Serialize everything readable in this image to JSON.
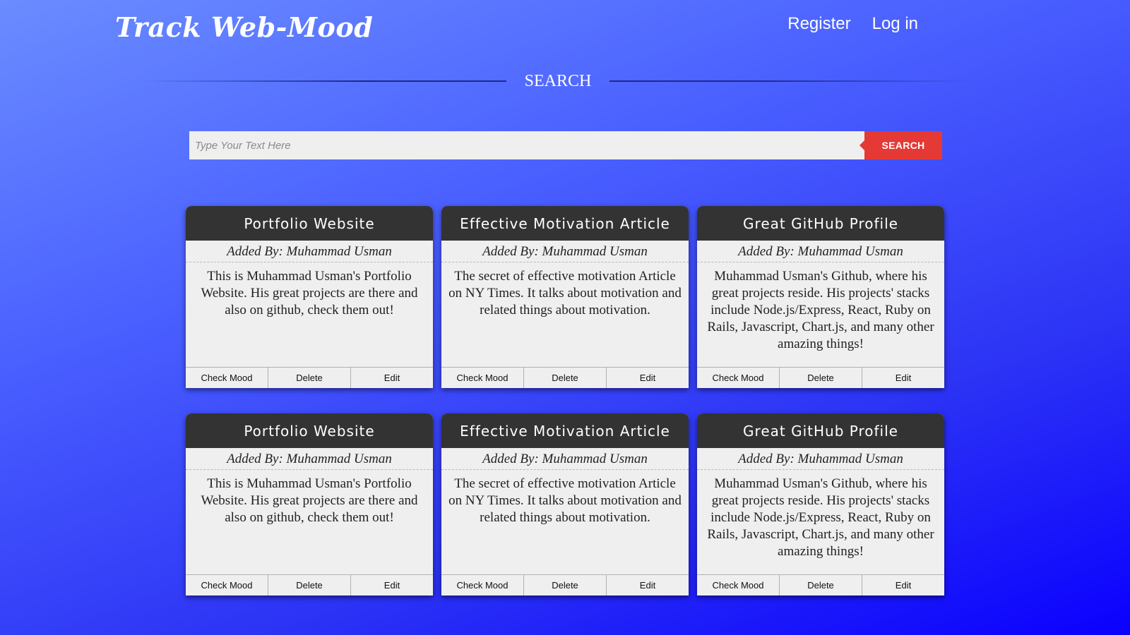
{
  "header": {
    "logo": "Track Web-Mood",
    "nav": [
      {
        "label": "Register"
      },
      {
        "label": "Log in"
      }
    ]
  },
  "search": {
    "heading": "SEARCH",
    "placeholder": "Type Your Text Here",
    "value": "",
    "button_label": "SEARCH"
  },
  "cards": [
    {
      "title": "Portfolio Website",
      "author": "Added By: Muhammad Usman",
      "description": "This is Muhammad Usman's Portfolio Website. His great projects are there and also on github, check them out!",
      "actions": [
        "Check Mood",
        "Delete",
        "Edit"
      ]
    },
    {
      "title": "Effective Motivation Article",
      "author": "Added By: Muhammad Usman",
      "description": "The secret of effective motivation Article on NY Times. It talks about motivation and related things about motivation.",
      "actions": [
        "Check Mood",
        "Delete",
        "Edit"
      ]
    },
    {
      "title": "Great GitHub Profile",
      "author": "Added By: Muhammad Usman",
      "description": "Muhammad Usman's Github, where his great projects reside. His projects' stacks include Node.js/Express, React, Ruby on Rails, Javascript, Chart.js, and many other amazing things!",
      "actions": [
        "Check Mood",
        "Delete",
        "Edit"
      ]
    },
    {
      "title": "Portfolio Website",
      "author": "Added By: Muhammad Usman",
      "description": "This is Muhammad Usman's Portfolio Website. His great projects are there and also on github, check them out!",
      "actions": [
        "Check Mood",
        "Delete",
        "Edit"
      ]
    },
    {
      "title": "Effective Motivation Article",
      "author": "Added By: Muhammad Usman",
      "description": "The secret of effective motivation Article on NY Times. It talks about motivation and related things about motivation.",
      "actions": [
        "Check Mood",
        "Delete",
        "Edit"
      ]
    },
    {
      "title": "Great GitHub Profile",
      "author": "Added By: Muhammad Usman",
      "description": "Muhammad Usman's Github, where his great projects reside. His projects' stacks include Node.js/Express, React, Ruby on Rails, Javascript, Chart.js, and many other amazing things!",
      "actions": [
        "Check Mood",
        "Delete",
        "Edit"
      ]
    }
  ]
}
